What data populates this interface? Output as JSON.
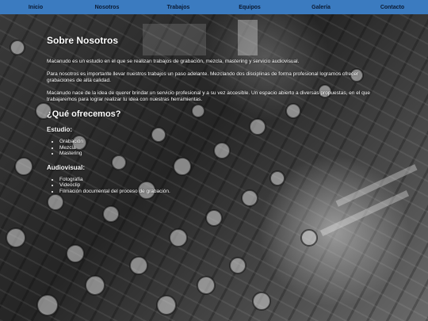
{
  "nav": {
    "items": [
      {
        "label": "Inicio"
      },
      {
        "label": "Nosotros"
      },
      {
        "label": "Trabajos"
      },
      {
        "label": "Equipos"
      },
      {
        "label": "Galería"
      },
      {
        "label": "Contacto"
      }
    ],
    "background": "#3b7bc0"
  },
  "about": {
    "title": "Sobre Nosotros",
    "paragraphs": [
      "Macanudo es un estudio en el que se realizan trabajos de grabación, mezcla, mastering y servicio audiovisual.",
      "Para nosotros es importante llevar nuestros trabajos un paso adelante. Mezclando dos disciplinas de forma profesional logramos ofrecer grabaciones de alta calidad.",
      "Macanudo nace de la idea de querer brindar un servicio profesional y a su vez accesible. Un espacio abierto a diversas propuestas, en el que trabajaremos para lograr realizar tu idea con nuestras herramientas."
    ]
  },
  "offer": {
    "title": "¿Qué ofrecemos?",
    "studio": {
      "title": "Estudio:",
      "items": [
        "Grabación",
        "Mezcla",
        "Mastering"
      ]
    },
    "audiovisual": {
      "title": "Audiovisual:",
      "items": [
        "Fotografía",
        "Videoclip",
        "Filmación documental del proceso de grabación."
      ]
    }
  },
  "background_image": "mixing-console-photo"
}
